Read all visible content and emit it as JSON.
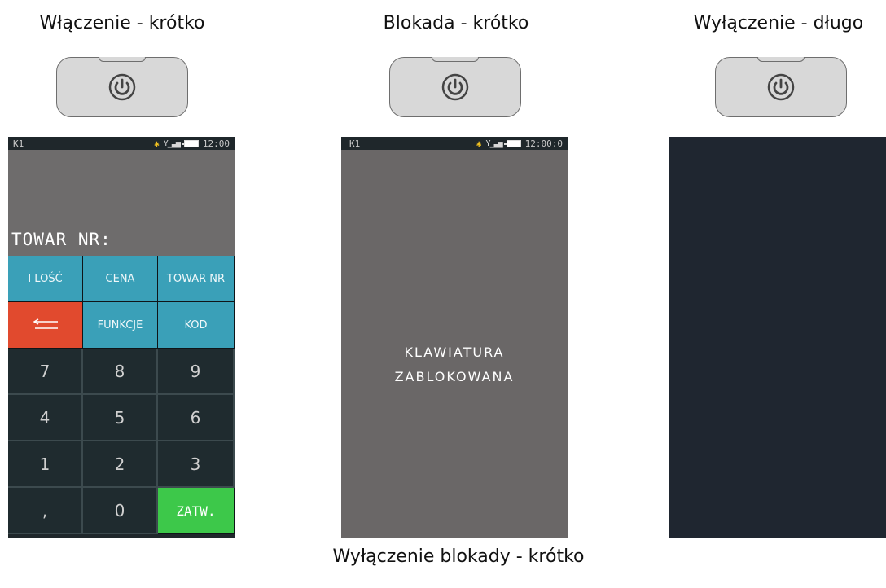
{
  "captions": {
    "power_on": "Włączenie - krótko",
    "lock": "Blokada - krótko",
    "power_off": "Wyłączenie - długo",
    "unlock": "Wyłączenie blokady - krótko"
  },
  "status_bar": {
    "left_label": "K1",
    "time_1": "12:00",
    "time_2": "12:00:0"
  },
  "screen_main": {
    "display_label": "TOWAR NR:",
    "keys": [
      {
        "label": "I LOŚĆ",
        "style": "teal"
      },
      {
        "label": "CENA",
        "style": "teal"
      },
      {
        "label": "TOWAR NR",
        "style": "teal"
      },
      {
        "label": "",
        "style": "red",
        "icon": "back-arrow-icon"
      },
      {
        "label": "FUNKCJE",
        "style": "teal"
      },
      {
        "label": "KOD",
        "style": "teal"
      },
      {
        "label": "7",
        "style": "num"
      },
      {
        "label": "8",
        "style": "num"
      },
      {
        "label": "9",
        "style": "num"
      },
      {
        "label": "4",
        "style": "num"
      },
      {
        "label": "5",
        "style": "num"
      },
      {
        "label": "6",
        "style": "num"
      },
      {
        "label": "1",
        "style": "num"
      },
      {
        "label": "2",
        "style": "num"
      },
      {
        "label": "3",
        "style": "num"
      },
      {
        "label": ",",
        "style": "num"
      },
      {
        "label": "0",
        "style": "num"
      },
      {
        "label": "ZATW.",
        "style": "green"
      }
    ]
  },
  "screen_locked": {
    "line1": "KLAWIATURA",
    "line2": "ZABLOKOWANA"
  },
  "colors": {
    "teal_key": "#3aa0b8",
    "red_key": "#e14a2e",
    "green_key": "#3dc84a",
    "dark_key": "#1f2b2f",
    "display_gray": "#6e6c6c",
    "off_screen": "#1f2630"
  },
  "icons": [
    "power-icon",
    "bluetooth-icon",
    "signal-icon",
    "battery-icon",
    "back-arrow-icon"
  ]
}
